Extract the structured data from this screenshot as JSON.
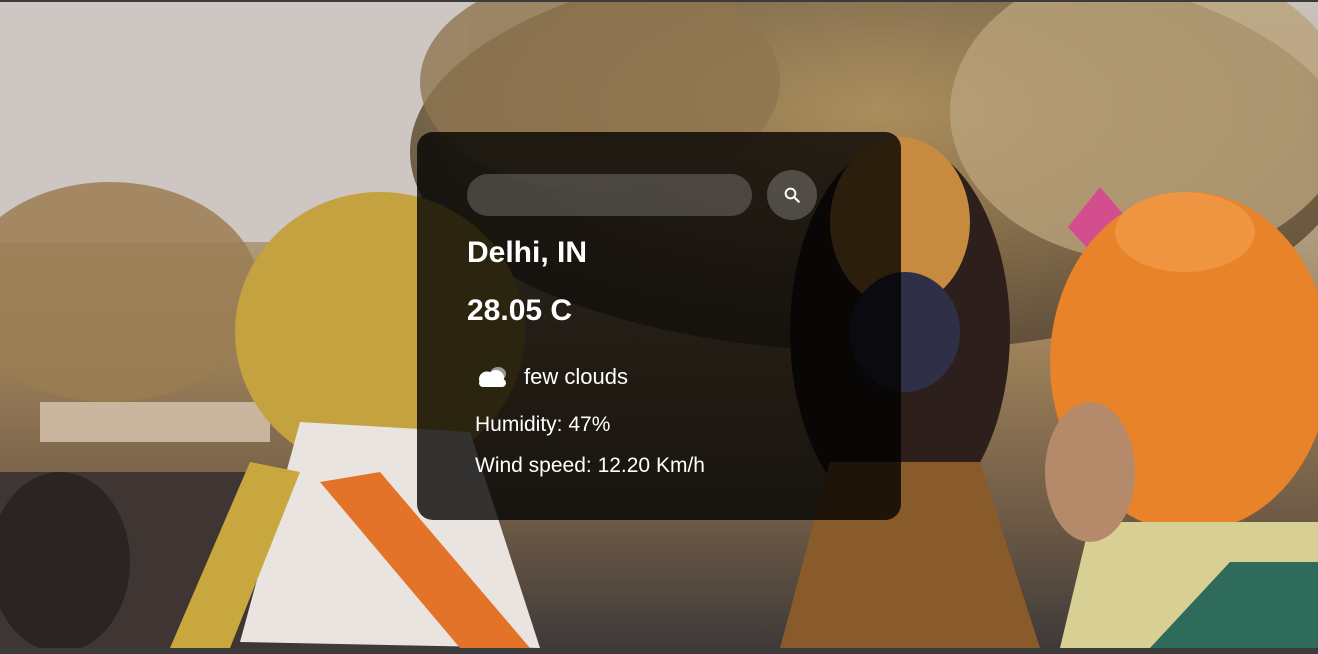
{
  "search": {
    "placeholder": "",
    "value": "",
    "button_icon": "search-icon"
  },
  "weather": {
    "city": "Delhi, IN",
    "temperature": "28.05 C",
    "condition_icon": "cloud-icon",
    "condition": "few clouds",
    "humidity": "Humidity: 47%",
    "wind": "Wind speed: 12.20 Km/h"
  },
  "colors": {
    "card_background": "#000000c7",
    "text": "#ffffff",
    "turban_orange": "#e8832a",
    "turban_yellow": "#c9a53e"
  }
}
